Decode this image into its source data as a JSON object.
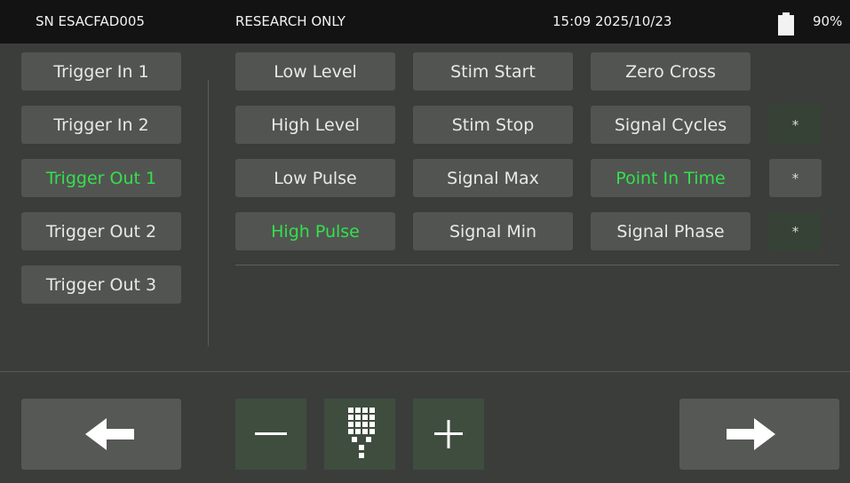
{
  "status": {
    "serial": "SN ESACFAD005",
    "mode": "RESEARCH ONLY",
    "datetime": "15:09 2025/10/23",
    "battery": "90%"
  },
  "triggers": [
    {
      "label": "Trigger In 1",
      "selected": false
    },
    {
      "label": "Trigger In 2",
      "selected": false
    },
    {
      "label": "Trigger Out 1",
      "selected": true
    },
    {
      "label": "Trigger Out 2",
      "selected": false
    },
    {
      "label": "Trigger Out 3",
      "selected": false
    }
  ],
  "options": {
    "col1": [
      "Low Level",
      "High Level",
      "Low Pulse",
      "High Pulse"
    ],
    "col2": [
      "Stim Start",
      "Stim Stop",
      "Signal Max",
      "Signal Min"
    ],
    "col3": [
      "Zero Cross",
      "Signal Cycles",
      "Point In Time",
      "Signal Phase"
    ],
    "selected": [
      "High Pulse",
      "Point In Time"
    ]
  },
  "stars": [
    "*",
    "*",
    "*"
  ],
  "icons": {
    "back": "left-arrow-icon",
    "minus": "minus-icon",
    "keypad": "keypad-icon",
    "plus": "plus-icon",
    "forward": "right-arrow-icon"
  },
  "colors": {
    "selected_text": "#33e14a",
    "button_bg": "#525452",
    "background": "#3b3d3b",
    "status_bg": "#131313"
  }
}
